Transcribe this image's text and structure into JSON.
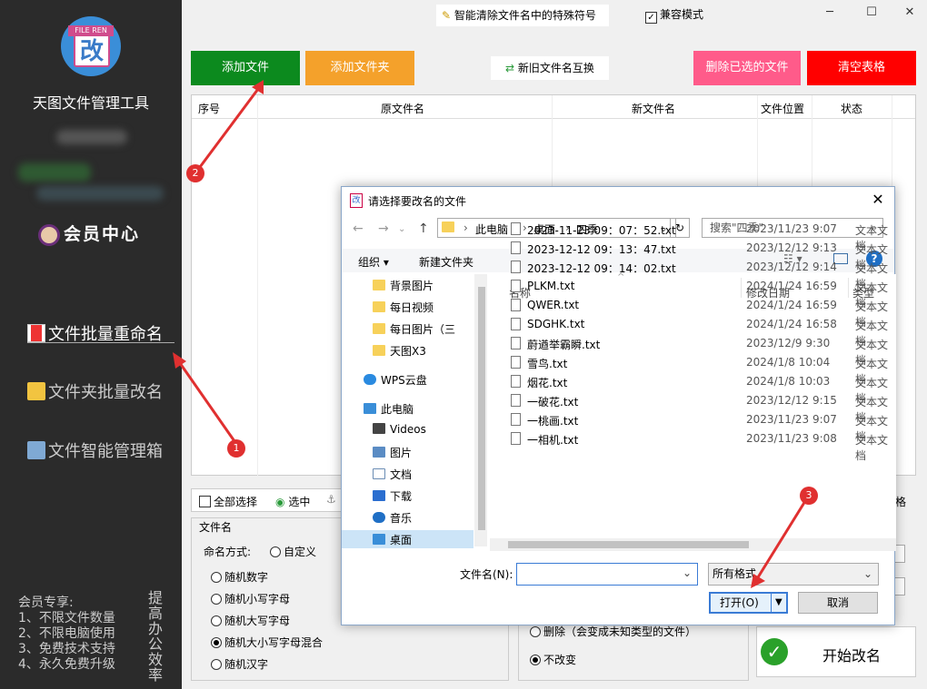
{
  "sidebar": {
    "logo_tag": "FILE REN",
    "logo_char": "改",
    "app_name": "天图文件管理工具",
    "member_center": "会员中心",
    "nav": [
      "文件批量重命名",
      "文件夹批量改名",
      "文件智能管理箱"
    ],
    "vip_lines": [
      "会员专享:",
      "1、不限文件数量",
      "2、不限电脑使用",
      "3、免费技术支持",
      "4、永久免费升级"
    ],
    "vip_vertical": "提高办公效率"
  },
  "topbar": {
    "feature_button": "智能清除文件名中的特殊符号",
    "compat_mode": "兼容模式",
    "compat_checked": "✓"
  },
  "window_controls": {
    "minimize": "─",
    "maximize": "☐",
    "close": "✕"
  },
  "toolbar": {
    "add_file": "添加文件",
    "add_folder": "添加文件夹",
    "swap": "新旧文件名互换",
    "delete_selected": "删除已选的文件",
    "clear_table": "清空表格"
  },
  "table": {
    "headers": [
      "序号",
      "原文件名",
      "新文件名",
      "文件位置",
      "状态"
    ]
  },
  "bottom": {
    "select_all": "全部选择",
    "select": "选中",
    "right_label": "格",
    "fname_group": "文件名",
    "naming_mode": "命名方式:",
    "custom": "自定义",
    "options": [
      "随机数字",
      "随机小写字母",
      "随机大写字母",
      "随机大小写字母混合",
      "随机汉字"
    ],
    "selected_option": 3,
    "ext_delete": "删除（会变成未知类型的文件）",
    "ext_keep": "不改变",
    "start": "开始改名"
  },
  "badges": [
    "1",
    "2",
    "3"
  ],
  "dialog": {
    "title": "请选择要改名的文件",
    "path": [
      "此电脑",
      "桌面",
      "四季"
    ],
    "search_placeholder": "搜索\"四季\"",
    "organize": "组织",
    "new_folder": "新建文件夹",
    "tree": [
      {
        "label": "背景图片",
        "icon": "folder"
      },
      {
        "label": "每日视频",
        "icon": "folder"
      },
      {
        "label": "每日图片（三",
        "icon": "folder"
      },
      {
        "label": "天图X3",
        "icon": "folder"
      },
      {
        "label": "WPS云盘",
        "icon": "cloud"
      },
      {
        "label": "此电脑",
        "icon": "computer"
      },
      {
        "label": "Videos",
        "icon": "video"
      },
      {
        "label": "图片",
        "icon": "picture"
      },
      {
        "label": "文档",
        "icon": "document"
      },
      {
        "label": "下载",
        "icon": "download"
      },
      {
        "label": "音乐",
        "icon": "music"
      },
      {
        "label": "桌面",
        "icon": "desktop"
      }
    ],
    "columns": [
      "名称",
      "修改日期",
      "类型"
    ],
    "files": [
      {
        "name": "2023-11-23 09：07：52.txt",
        "date": "2023/11/23 9:07",
        "type": "文本文档"
      },
      {
        "name": "2023-12-12 09：13：47.txt",
        "date": "2023/12/12 9:13",
        "type": "文本文档"
      },
      {
        "name": "2023-12-12 09：14：02.txt",
        "date": "2023/12/12 9:14",
        "type": "文本文档"
      },
      {
        "name": "PLKM.txt",
        "date": "2024/1/24 16:59",
        "type": "文本文档"
      },
      {
        "name": "QWER.txt",
        "date": "2024/1/24 16:59",
        "type": "文本文档"
      },
      {
        "name": "SDGHK.txt",
        "date": "2024/1/24 16:58",
        "type": "文本文档"
      },
      {
        "name": "蔚遒举霸瞬.txt",
        "date": "2023/12/9 9:30",
        "type": "文本文档"
      },
      {
        "name": "雪鸟.txt",
        "date": "2024/1/8 10:04",
        "type": "文本文档"
      },
      {
        "name": "烟花.txt",
        "date": "2024/1/8 10:03",
        "type": "文本文档"
      },
      {
        "name": "一破花.txt",
        "date": "2023/12/12 9:15",
        "type": "文本文档"
      },
      {
        "name": "一桃画.txt",
        "date": "2023/11/23 9:07",
        "type": "文本文档"
      },
      {
        "name": "一相机.txt",
        "date": "2023/11/23 9:08",
        "type": "文本文档"
      }
    ],
    "filename_label": "文件名(N):",
    "filename_value": "",
    "filter": "所有格式",
    "open": "打开(O)",
    "cancel": "取消"
  }
}
